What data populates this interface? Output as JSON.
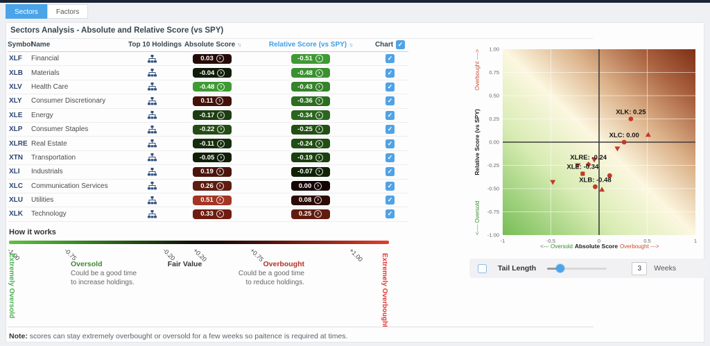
{
  "tabs": [
    {
      "label": "Sectors",
      "active": true
    },
    {
      "label": "Factors",
      "active": false
    }
  ],
  "title": "Sectors Analysis - Absolute and Relative Score (vs SPY)",
  "colors": {
    "accent_blue": "#4ba3e8",
    "relative_header_blue": "#3f9ee3",
    "marker_red": "#c13a26",
    "oversold_green": "#3d8b2f",
    "overbought_red": "#b23121"
  },
  "table": {
    "headers": {
      "symbol": "Symbol",
      "name": "Name",
      "holdings": "Top 10 Holdings",
      "absolute": "Absolute Score",
      "relative": "Relative Score (vs SPY)",
      "chart": "Chart"
    },
    "rows": [
      {
        "symbol": "XLF",
        "name": "Financial",
        "absolute": "0.03",
        "absolute_color": "#250b07",
        "relative": "-0.51",
        "relative_color": "#3e9a33",
        "checked": true
      },
      {
        "symbol": "XLB",
        "name": "Materials",
        "absolute": "-0.04",
        "absolute_color": "#101d08",
        "relative": "-0.48",
        "relative_color": "#3a9130",
        "checked": true
      },
      {
        "symbol": "XLV",
        "name": "Health Care",
        "absolute": "-0.48",
        "absolute_color": "#3e9a33",
        "relative": "-0.43",
        "relative_color": "#35832a",
        "checked": true
      },
      {
        "symbol": "XLY",
        "name": "Consumer Discretionary",
        "absolute": "0.11",
        "absolute_color": "#42120a",
        "relative": "-0.36",
        "relative_color": "#2c6d20",
        "checked": true
      },
      {
        "symbol": "XLE",
        "name": "Energy",
        "absolute": "-0.17",
        "absolute_color": "#1d3d12",
        "relative": "-0.34",
        "relative_color": "#2a661e",
        "checked": true
      },
      {
        "symbol": "XLP",
        "name": "Consumer Staples",
        "absolute": "-0.22",
        "absolute_color": "#244c16",
        "relative": "-0.25",
        "relative_color": "#225014",
        "checked": true
      },
      {
        "symbol": "XLRE",
        "name": "Real Estate",
        "absolute": "-0.11",
        "absolute_color": "#162d0d",
        "relative": "-0.24",
        "relative_color": "#214e13",
        "checked": true
      },
      {
        "symbol": "XTN",
        "name": "Transportation",
        "absolute": "-0.05",
        "absolute_color": "#111f08",
        "relative": "-0.19",
        "relative_color": "#1b3f0e",
        "checked": true
      },
      {
        "symbol": "XLI",
        "name": "Industrials",
        "absolute": "0.19",
        "absolute_color": "#4a140d",
        "relative": "-0.07",
        "relative_color": "#0f2206",
        "checked": true
      },
      {
        "symbol": "XLC",
        "name": "Communication Services",
        "absolute": "0.26",
        "absolute_color": "#5f1b10",
        "relative": "0.00",
        "relative_color": "#140503",
        "checked": true
      },
      {
        "symbol": "XLU",
        "name": "Utilities",
        "absolute": "0.51",
        "absolute_color": "#a33524",
        "relative": "0.08",
        "relative_color": "#2c0b06",
        "checked": true
      },
      {
        "symbol": "XLK",
        "name": "Technology",
        "absolute": "0.33",
        "absolute_color": "#6e1d10",
        "relative": "0.25",
        "relative_color": "#611c10",
        "checked": true
      }
    ]
  },
  "how_it_works": {
    "title": "How it works",
    "scale_ticks": [
      {
        "label": "-1.00",
        "pos": 0.5
      },
      {
        "label": "-0.75",
        "pos": 15.5
      },
      {
        "label": "-0.20",
        "pos": 41.5
      },
      {
        "label": "+0.20",
        "pos": 49.5
      },
      {
        "label": "+0.75",
        "pos": 64.5
      },
      {
        "label": "+1.00",
        "pos": 90.5
      }
    ],
    "extreme_left": "Extremely Oversold",
    "oversold": {
      "title": "Oversold",
      "line1": "Could be a good time",
      "line2": "to increase holdings."
    },
    "fair": "Fair Value",
    "overbought": {
      "title": "Overbought",
      "line1": "Could be a good time",
      "line2": "to reduce holdings."
    },
    "extreme_right": "Extremely Overbought"
  },
  "note": {
    "label": "Note:",
    "text": "scores can stay extremely overbought or oversold for a few weeks so paitence is required at times."
  },
  "chart_data": {
    "type": "scatter",
    "xlabel": "Absolute Score",
    "ylabel": "Relative Score (vs SPY)",
    "x_axis_left_annotation": "<--- Oversold",
    "x_axis_right_annotation": "Overbought --->",
    "y_axis_bottom_annotation": "<---- Oversold",
    "y_axis_top_annotation": "Overbought ---->",
    "xlim": [
      -1,
      1
    ],
    "ylim": [
      -1,
      1
    ],
    "x_ticks": [
      "-1",
      "-0.5",
      "0",
      "0.5",
      "1"
    ],
    "y_ticks": [
      "1.00",
      "0.75",
      "0.50",
      "0.25",
      "0.00",
      "-0.25",
      "-0.50",
      "-0.75",
      "-1.00"
    ],
    "grid": true,
    "marker_color": "#c13a26",
    "points": [
      {
        "symbol": "XLF",
        "x": 0.03,
        "y": -0.51,
        "marker": "triangle-up"
      },
      {
        "symbol": "XLB",
        "x": -0.04,
        "y": -0.48,
        "marker": "circle",
        "label": "XLB: -0.48"
      },
      {
        "symbol": "XLV",
        "x": -0.48,
        "y": -0.43,
        "marker": "triangle-down"
      },
      {
        "symbol": "XLY",
        "x": 0.11,
        "y": -0.36,
        "marker": "circle"
      },
      {
        "symbol": "XLE",
        "x": -0.17,
        "y": -0.34,
        "marker": "square",
        "label": "XLE: -0.34"
      },
      {
        "symbol": "XLP",
        "x": -0.22,
        "y": -0.25,
        "marker": "triangle-down"
      },
      {
        "symbol": "XLRE",
        "x": -0.11,
        "y": -0.24,
        "marker": "diamond",
        "label": "XLRE: -0.24"
      },
      {
        "symbol": "XTN",
        "x": -0.05,
        "y": -0.19,
        "marker": "triangle-down"
      },
      {
        "symbol": "XLI",
        "x": 0.19,
        "y": -0.07,
        "marker": "triangle-down"
      },
      {
        "symbol": "XLC",
        "x": 0.26,
        "y": 0.0,
        "marker": "circle",
        "label": "XLC: 0.00"
      },
      {
        "symbol": "XLU",
        "x": 0.51,
        "y": 0.08,
        "marker": "triangle-up"
      },
      {
        "symbol": "XLK",
        "x": 0.33,
        "y": 0.25,
        "marker": "circle",
        "label": "XLK: 0.25"
      }
    ]
  },
  "tail_control": {
    "label": "Tail Length",
    "value": "3",
    "unit": "Weeks",
    "checked": false
  }
}
